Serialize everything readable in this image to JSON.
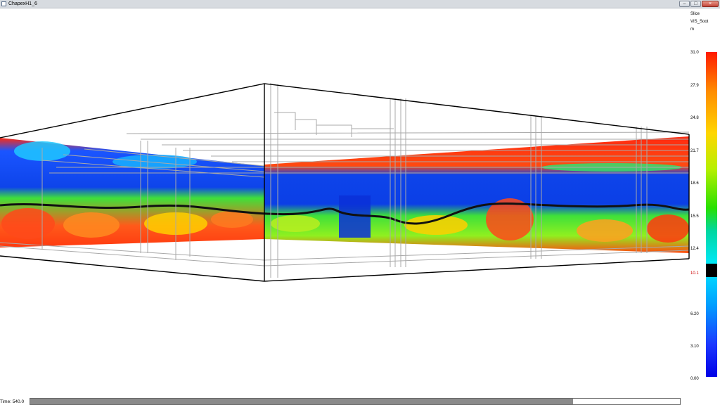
{
  "window": {
    "title": "ChapexH1_6",
    "app_icon": "smokeview-window-icon",
    "controls": {
      "minimize": "–",
      "maximize": "□",
      "close": "×"
    }
  },
  "colorbar": {
    "header": [
      "Slice",
      "VIS_Soot",
      "m"
    ],
    "ticks": [
      "31.0",
      "27.9",
      "24.8",
      "21.7",
      "18.6",
      "15.5",
      "12.4",
      "10.1",
      "6.20",
      "3.10",
      "0.00"
    ],
    "current_value": "10.1",
    "colors": [
      "#ff1a00",
      "#ff8c00",
      "#ffd600",
      "#28e000",
      "#00e9ff",
      "#009dff",
      "#0000e6"
    ]
  },
  "status": {
    "time_label": "Time: 540.0",
    "progress": 0.835
  },
  "scene": {
    "colors": {
      "wall_top": "#ff3a10",
      "smoke_layer": "#0b3fe6",
      "floor_field": "#3fe03a",
      "hot_spot": "#ff6a22",
      "frame": "#000000",
      "geometry": "#a9a9a9"
    }
  }
}
